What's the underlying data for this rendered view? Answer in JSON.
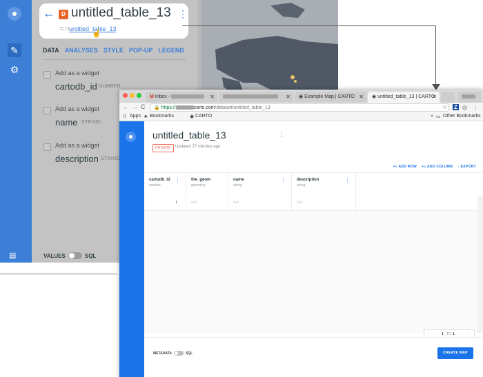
{
  "background_editor": {
    "title": "untitled_table_13",
    "layer_badge": "D",
    "source_link": "untitled_table_13",
    "tabs": [
      {
        "label": "DATA",
        "active": true
      },
      {
        "label": "ANALYSES",
        "active": false
      },
      {
        "label": "STYLE",
        "active": false
      },
      {
        "label": "POP-UP",
        "active": false
      },
      {
        "label": "LEGEND",
        "active": false
      }
    ],
    "widget_label": "Add as a widget",
    "fields": [
      {
        "name": "cartodb_id",
        "type": "NUMBER"
      },
      {
        "name": "name",
        "type": "STRING"
      },
      {
        "name": "description",
        "type": "STRING"
      }
    ],
    "values_label": "VALUES",
    "sql_label": "SQL"
  },
  "browser": {
    "tabs": [
      {
        "label": "Inbox -",
        "icon": "gmail-icon",
        "active": false
      },
      {
        "label": "",
        "icon": "blurred-tab-icon",
        "active": false
      },
      {
        "label": "Example Map | CARTO",
        "icon": "carto-icon",
        "active": false
      },
      {
        "label": "untitled_table_13 | CARTO",
        "icon": "carto-icon",
        "active": true
      }
    ],
    "url": {
      "scheme": "https://",
      "domain": "carto.com",
      "path": "/dataset/untitled_table_13"
    },
    "bookmarks": {
      "apps": "Apps",
      "bookmarks": "Bookmarks",
      "carto": "CARTO",
      "other": "Other Bookmarks"
    }
  },
  "dataset": {
    "title": "untitled_table_13",
    "privacy": "PRIVATE",
    "updated": "Updated 27 minutes ago",
    "actions": {
      "add_row": "ADD ROW",
      "add_column": "ADD COLUMN",
      "export": "EXPORT"
    },
    "columns": [
      {
        "name": "cartodb_id",
        "type": "number"
      },
      {
        "name": "the_geom",
        "type": "geometry"
      },
      {
        "name": "name",
        "type": "string"
      },
      {
        "name": "description",
        "type": "string"
      }
    ],
    "row": {
      "cartodb_id": "1",
      "the_geom": "null",
      "name": "null",
      "description": "null"
    },
    "pager": {
      "from": "1",
      "to_label": "TO",
      "to": "1"
    },
    "metadata_label": "METADATA",
    "sql_label": "SQL",
    "create_map": "CREATE MAP"
  },
  "colors": {
    "carto_blue": "#1a73e8",
    "builder_blue": "#3d7fd6",
    "layer_orange": "#e8662a",
    "private_red": "#f06c5c"
  }
}
